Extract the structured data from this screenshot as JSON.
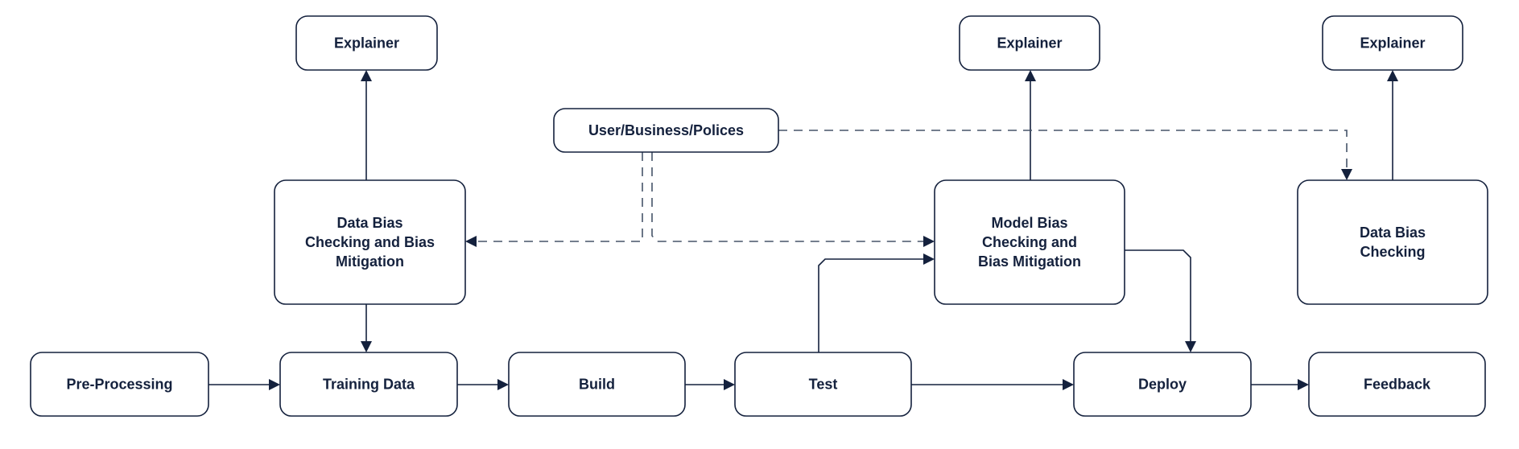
{
  "diagram": {
    "colors": {
      "stroke": "#14213d",
      "text": "#14213d",
      "dashed": "#465469",
      "background": "#ffffff"
    },
    "nodes": [
      {
        "id": "explainer-1",
        "lines": [
          "Explainer"
        ]
      },
      {
        "id": "explainer-2",
        "lines": [
          "Explainer"
        ]
      },
      {
        "id": "explainer-3",
        "lines": [
          "Explainer"
        ]
      },
      {
        "id": "user-business-polices",
        "lines": [
          "User/Business/Polices"
        ]
      },
      {
        "id": "data-bias-checking-mitigation",
        "lines": [
          "Data Bias",
          "Checking and Bias",
          "Mitigation"
        ]
      },
      {
        "id": "model-bias-checking-mitigation",
        "lines": [
          "Model Bias",
          "Checking and",
          "Bias Mitigation"
        ]
      },
      {
        "id": "data-bias-checking",
        "lines": [
          "Data Bias",
          "Checking"
        ]
      },
      {
        "id": "pre-processing",
        "lines": [
          "Pre-Processing"
        ]
      },
      {
        "id": "training-data",
        "lines": [
          "Training Data"
        ]
      },
      {
        "id": "build",
        "lines": [
          "Build"
        ]
      },
      {
        "id": "test",
        "lines": [
          "Test"
        ]
      },
      {
        "id": "deploy",
        "lines": [
          "Deploy"
        ]
      },
      {
        "id": "feedback",
        "lines": [
          "Feedback"
        ]
      }
    ],
    "edges": [
      {
        "from": "pre-processing",
        "to": "training-data",
        "style": "solid"
      },
      {
        "from": "training-data",
        "to": "build",
        "style": "solid"
      },
      {
        "from": "build",
        "to": "test",
        "style": "solid"
      },
      {
        "from": "test",
        "to": "deploy",
        "style": "solid"
      },
      {
        "from": "deploy",
        "to": "feedback",
        "style": "solid"
      },
      {
        "from": "data-bias-checking-mitigation",
        "to": "explainer-1",
        "style": "solid"
      },
      {
        "from": "data-bias-checking-mitigation",
        "to": "training-data",
        "style": "solid"
      },
      {
        "from": "model-bias-checking-mitigation",
        "to": "explainer-2",
        "style": "solid"
      },
      {
        "from": "data-bias-checking",
        "to": "explainer-3",
        "style": "solid"
      },
      {
        "from": "test",
        "to": "model-bias-checking-mitigation",
        "style": "solid"
      },
      {
        "from": "model-bias-checking-mitigation",
        "to": "deploy",
        "style": "solid"
      },
      {
        "from": "user-business-polices",
        "to": "data-bias-checking-mitigation",
        "style": "dashed"
      },
      {
        "from": "user-business-polices",
        "to": "model-bias-checking-mitigation",
        "style": "dashed"
      },
      {
        "from": "user-business-polices",
        "to": "data-bias-checking",
        "style": "dashed"
      }
    ]
  }
}
